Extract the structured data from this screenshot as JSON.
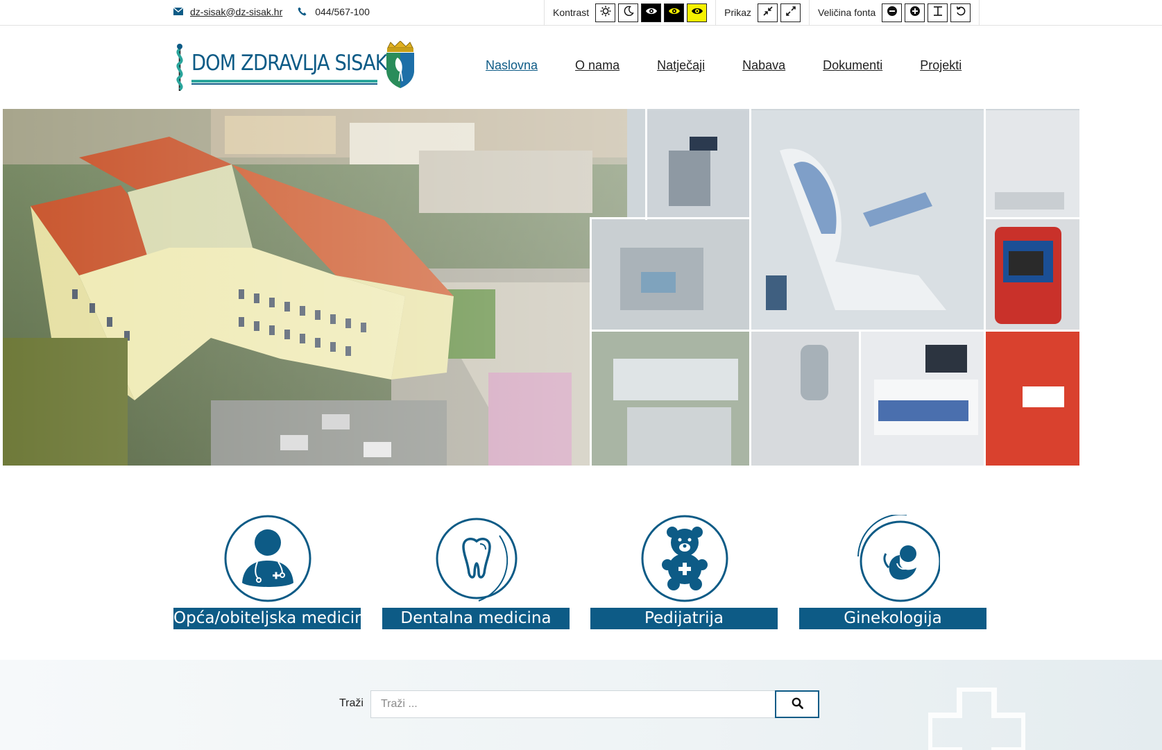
{
  "topbar": {
    "email": "dz-sisak@dz-sisak.hr",
    "phone": "044/567-100",
    "icons": {
      "email": "envelope-icon",
      "phone": "phone-icon"
    }
  },
  "accessibility": {
    "contrast_label": "Kontrast",
    "view_label": "Prikaz",
    "font_label": "Veličina fonta",
    "contrast_buttons": [
      "sun-icon",
      "moon-icon",
      "eye-white-on-black-icon",
      "eye-yellow-on-black-icon",
      "eye-black-on-yellow-icon"
    ],
    "view_buttons": [
      "compress-icon",
      "expand-icon"
    ],
    "font_buttons": [
      "minus-circle-icon",
      "plus-circle-icon",
      "text-cursor-icon",
      "reset-icon"
    ]
  },
  "header": {
    "logo_text": "DOM ZDRAVLJA SISAK",
    "nav": [
      {
        "label": "Naslovna",
        "active": true
      },
      {
        "label": "O nama",
        "active": false
      },
      {
        "label": "Natječaji",
        "active": false
      },
      {
        "label": "Nabava",
        "active": false
      },
      {
        "label": "Dokumenti",
        "active": false
      },
      {
        "label": "Projekti",
        "active": false
      }
    ]
  },
  "services": [
    {
      "label": "Opća/obiteljska medicina",
      "icon": "doctor-icon"
    },
    {
      "label": "Dentalna medicina",
      "icon": "tooth-icon"
    },
    {
      "label": "Pedijatrija",
      "icon": "teddy-bear-icon"
    },
    {
      "label": "Ginekologija",
      "icon": "fetus-icon"
    }
  ],
  "search": {
    "label": "Traži",
    "placeholder": "Traži ...",
    "button_icon": "search-icon"
  },
  "colors": {
    "brand": "#0d5b86",
    "accent": "#2aa59c",
    "highlight_yellow": "#f6f100"
  }
}
